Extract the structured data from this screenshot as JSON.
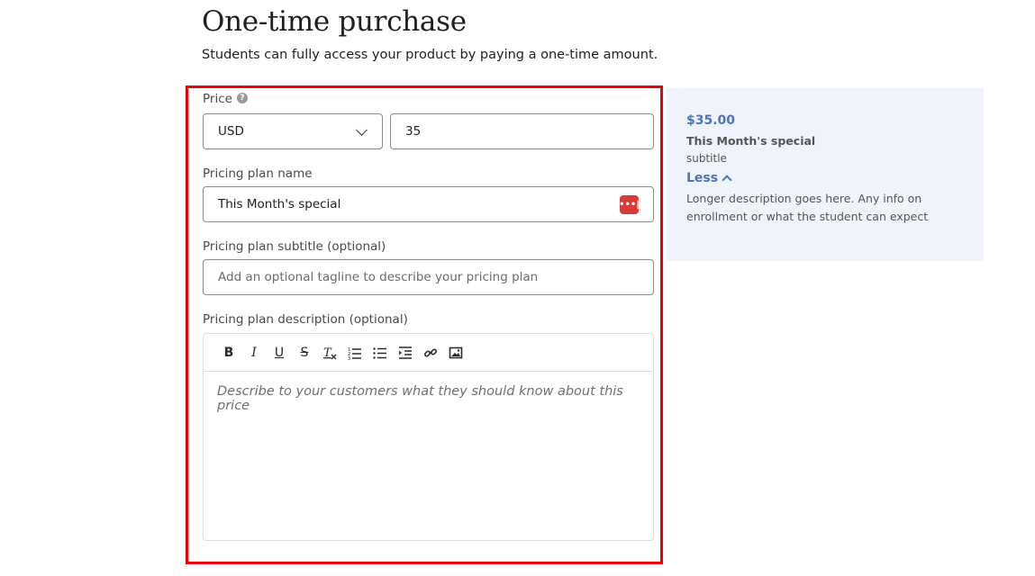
{
  "page": {
    "title": "One-time purchase",
    "subtitle": "Students can fully access your product by paying a one-time amount."
  },
  "form": {
    "price_label": "Price",
    "currency_value": "USD",
    "amount_value": "35",
    "plan_name_label": "Pricing plan name",
    "plan_name_value": "This Month's special",
    "plan_subtitle_label": "Pricing plan subtitle (optional)",
    "plan_subtitle_placeholder": "Add an optional tagline to describe your pricing plan",
    "plan_description_label": "Pricing plan description (optional)",
    "plan_description_placeholder": "Describe to your customers what they should know about this price",
    "toolbar_icons": [
      "bold-icon",
      "italic-icon",
      "underline-icon",
      "strikethrough-icon",
      "clear-format-icon",
      "ordered-list-icon",
      "bullet-list-icon",
      "indent-icon",
      "link-icon",
      "image-icon"
    ]
  },
  "preview": {
    "price": "$35.00",
    "name": "This Month's special",
    "subtitle": "subtitle",
    "toggle_label": "Less",
    "description": "Longer description goes here. Any info on enrollment or what the student can expect"
  },
  "colors": {
    "highlight_border": "#e8000b",
    "preview_bg": "#eef3fc",
    "accent": "#4e73b8",
    "password_icon_bg": "#d83a3a"
  }
}
